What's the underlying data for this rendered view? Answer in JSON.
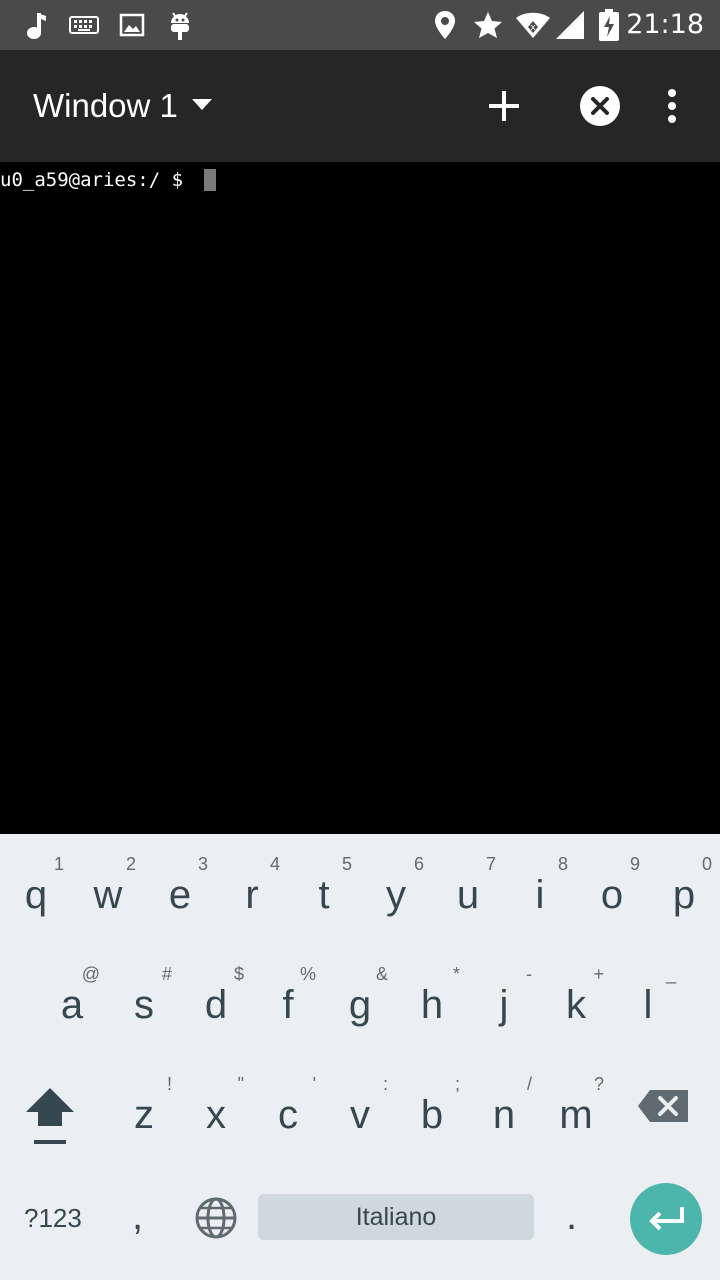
{
  "status_bar": {
    "icons": [
      "music-note-icon",
      "keyboard-icon",
      "image-icon",
      "android-icon",
      "location-icon",
      "star-icon",
      "wifi-icon",
      "signal-icon",
      "battery-charging-icon"
    ],
    "time": "21:18"
  },
  "app_bar": {
    "title": "Window 1",
    "icons": [
      "dropdown-arrow-icon",
      "add-icon",
      "close-circle-icon",
      "more-vert-icon"
    ]
  },
  "terminal": {
    "prompt": "u0_a59@aries:/ $"
  },
  "keyboard": {
    "row1": [
      {
        "key": "q",
        "hint": "1"
      },
      {
        "key": "w",
        "hint": "2"
      },
      {
        "key": "e",
        "hint": "3"
      },
      {
        "key": "r",
        "hint": "4"
      },
      {
        "key": "t",
        "hint": "5"
      },
      {
        "key": "y",
        "hint": "6"
      },
      {
        "key": "u",
        "hint": "7"
      },
      {
        "key": "i",
        "hint": "8"
      },
      {
        "key": "o",
        "hint": "9"
      },
      {
        "key": "p",
        "hint": "0"
      }
    ],
    "row2": [
      {
        "key": "a",
        "hint": "@"
      },
      {
        "key": "s",
        "hint": "#"
      },
      {
        "key": "d",
        "hint": "$"
      },
      {
        "key": "f",
        "hint": "%"
      },
      {
        "key": "g",
        "hint": "&"
      },
      {
        "key": "h",
        "hint": "*"
      },
      {
        "key": "j",
        "hint": "-"
      },
      {
        "key": "k",
        "hint": "+"
      },
      {
        "key": "l",
        "hint": "_"
      }
    ],
    "row3": [
      {
        "key": "z",
        "hint": "!"
      },
      {
        "key": "x",
        "hint": "\""
      },
      {
        "key": "c",
        "hint": "'"
      },
      {
        "key": "v",
        "hint": ":"
      },
      {
        "key": "b",
        "hint": ";"
      },
      {
        "key": "n",
        "hint": "/"
      },
      {
        "key": "m",
        "hint": "?"
      }
    ],
    "symbols_label": "?123",
    "comma": ",",
    "period": ".",
    "space_label": "Italiano",
    "accent_color": "#4db6ac"
  }
}
